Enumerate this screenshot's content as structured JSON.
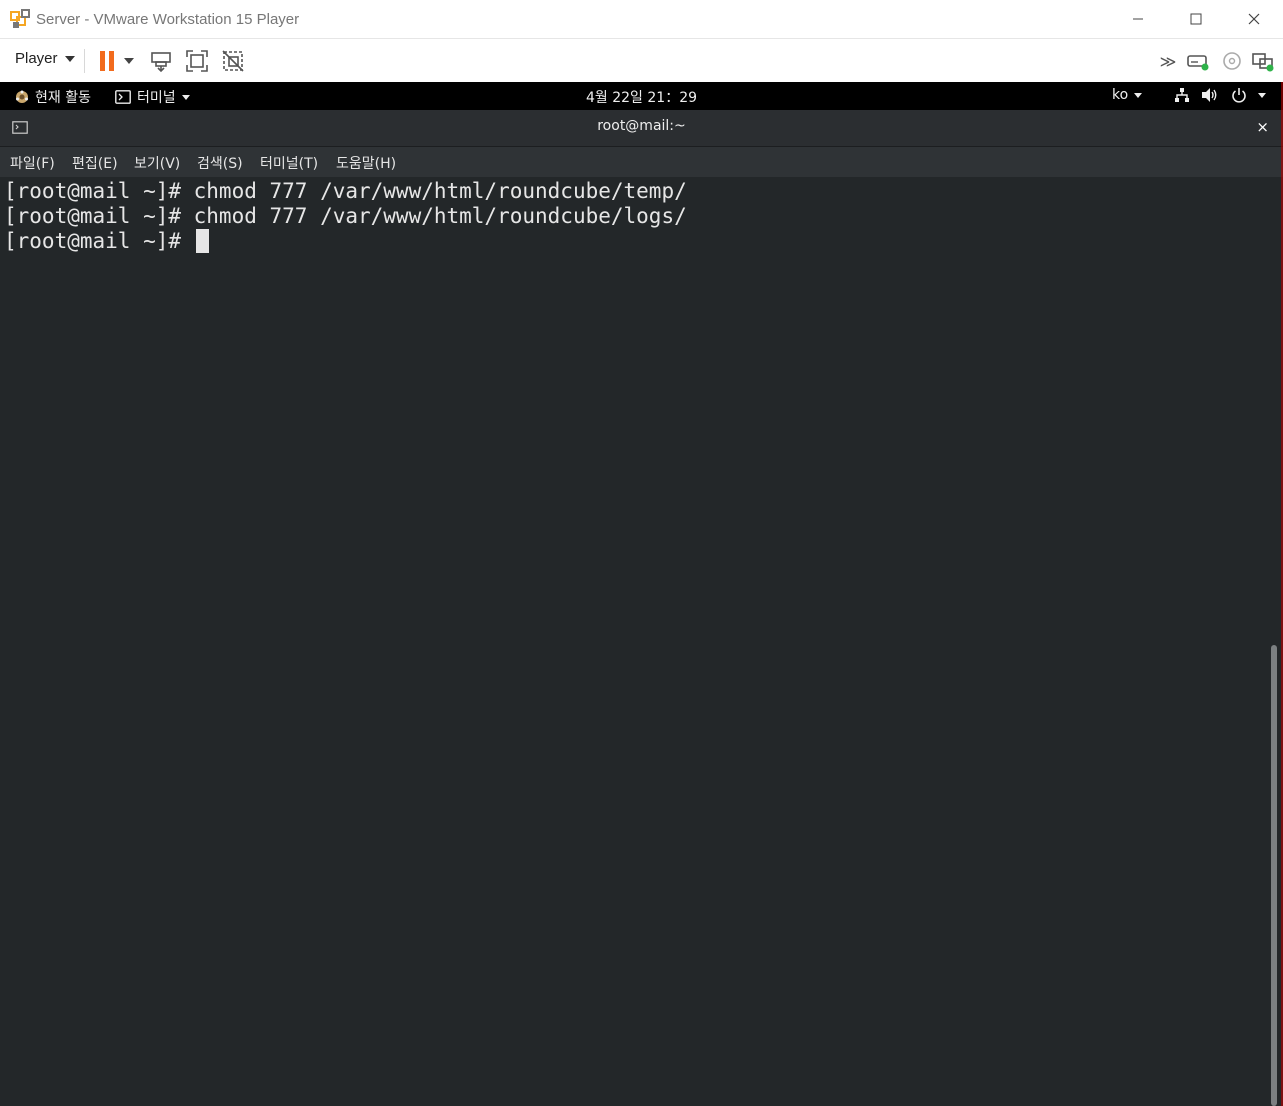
{
  "window": {
    "title": "Server - VMware Workstation 15 Player",
    "icons": [
      "vmware-logo-icon",
      "minimize-icon",
      "maximize-icon",
      "close-icon"
    ]
  },
  "toolbar": {
    "player_label": "Player",
    "icons": [
      "pause-icon",
      "send-ctrl-alt-del-icon",
      "fullscreen-icon",
      "unity-icon",
      "more-icon",
      "hard-disk-icon",
      "cd-icon",
      "network-adapter-icon"
    ],
    "accent_color": "#f26b1d"
  },
  "gnome": {
    "activities": "현재 활동",
    "app_menu": "터미널",
    "clock": "4월 22일  21：29",
    "input_lang": "ko"
  },
  "terminal": {
    "title": "root@mail:~",
    "close": "×",
    "menus": [
      "파일(F)",
      "편집(E)",
      "보기(V)",
      "검색(S)",
      "터미널(T)",
      "도움말(H)"
    ],
    "lines": [
      "[root@mail ~]# chmod 777 /var/www/html/roundcube/temp/",
      "[root@mail ~]# chmod 777 /var/www/html/roundcube/logs/",
      "[root@mail ~]# "
    ],
    "background": "#232729",
    "foreground": "#e6e6e6"
  }
}
